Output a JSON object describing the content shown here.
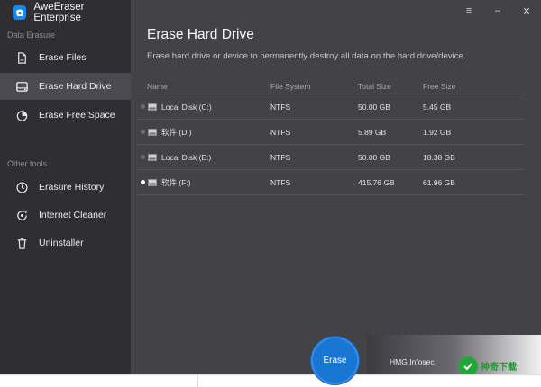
{
  "app": {
    "title": "AweEraser Enterprise",
    "icon": "app-logo-icon"
  },
  "window_controls": [
    {
      "name": "menu-button",
      "glyph": "≡"
    },
    {
      "name": "minimize-button",
      "glyph": "–"
    },
    {
      "name": "close-button",
      "glyph": "✕"
    }
  ],
  "sidebar": {
    "section1_label": "Data Erasure",
    "section2_label": "Other tools",
    "items": [
      {
        "label": "Erase Files",
        "icon": "file-icon",
        "active": false
      },
      {
        "label": "Erase Hard Drive",
        "icon": "hard-drive-icon",
        "active": true
      },
      {
        "label": "Erase Free Space",
        "icon": "pie-chart-icon",
        "active": false
      },
      {
        "label": "Erasure History",
        "icon": "history-clock-icon",
        "active": false
      },
      {
        "label": "Internet Cleaner",
        "icon": "browser-cleaner-icon",
        "active": false
      },
      {
        "label": "Uninstaller",
        "icon": "trash-bin-icon",
        "active": false
      }
    ]
  },
  "main": {
    "title": "Erase Hard Drive",
    "description": "Erase hard drive or device to permanently destroy all data on the hard drive/device.",
    "columns": [
      "Name",
      "File System",
      "Total Size",
      "Free Size"
    ],
    "rows": [
      {
        "name": "Local Disk (C:)",
        "fs": "NTFS",
        "total": "50.00 GB",
        "free": "5.45 GB",
        "selected": false
      },
      {
        "name": "软件 (D:)",
        "fs": "NTFS",
        "total": "5.89 GB",
        "free": "1.92 GB",
        "selected": false
      },
      {
        "name": "Local Disk (E:)",
        "fs": "NTFS",
        "total": "50.00 GB",
        "free": "18.38 GB",
        "selected": false
      },
      {
        "name": "软件 (F:)",
        "fs": "NTFS",
        "total": "415.76 GB",
        "free": "61.96 GB",
        "selected": true
      }
    ],
    "erase_label": "Erase"
  },
  "footer": {
    "company": "HMG Infosec",
    "watermark_text": "神奇下载"
  },
  "colors": {
    "sidebar_bg": "#2f2f33",
    "main_bg": "#434347",
    "accent": "#1976d2"
  }
}
